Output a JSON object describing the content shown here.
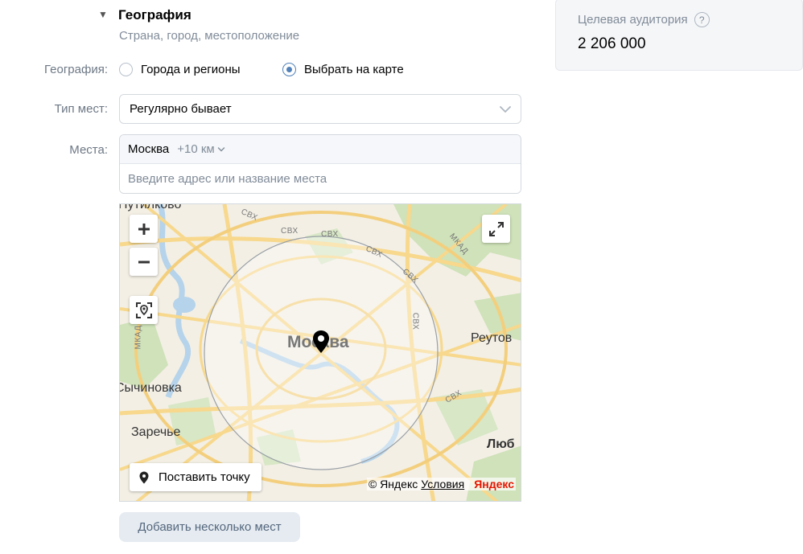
{
  "section": {
    "title": "География",
    "subtitle": "Страна, город, местоположение"
  },
  "geography": {
    "label": "География:",
    "options": [
      {
        "label": "Города и регионы",
        "selected": false
      },
      {
        "label": "Выбрать на карте",
        "selected": true
      }
    ]
  },
  "place_type": {
    "label": "Тип мест:",
    "value": "Регулярно бывает"
  },
  "places": {
    "label": "Места:",
    "chip_city": "Москва",
    "chip_radius": "+10 км",
    "input_placeholder": "Введите адрес или название места"
  },
  "map": {
    "city_label": "Москва",
    "labels": [
      "Путилково",
      "Реутов",
      "Сычиновка",
      "Заречье",
      "Люб"
    ],
    "road_labels": [
      "СВХ",
      "СВХ",
      "СВХ",
      "СВХ",
      "СВХ",
      "СВХ",
      "СВХ",
      "МКАД",
      "МКАД"
    ],
    "set_point_label": "Поставить точку",
    "copyright": "© Яндекс",
    "terms_link": "Условия",
    "logo_text": "Яндекс",
    "colors": {
      "background": "#f3efe5",
      "road": "#f7d88c",
      "water": "#b5d3ea",
      "park": "#cfe2b9",
      "radius_circle": "#9aa0a6"
    }
  },
  "add_places_button": "Добавить несколько мест",
  "audience": {
    "title": "Целевая аудитория",
    "help_icon": "?",
    "value": "2 206 000"
  },
  "colors": {
    "accent": "#5181b8",
    "label_gray": "#6d7885",
    "muted": "#818c99",
    "button_bg": "#e5ebf1",
    "button_text": "#55677d"
  }
}
